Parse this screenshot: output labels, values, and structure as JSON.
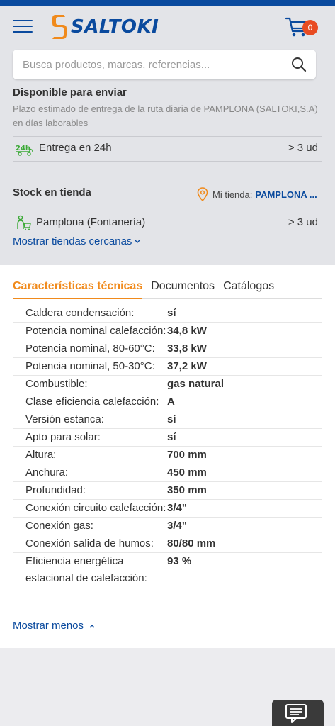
{
  "header": {
    "logo_text": "SALTOKI",
    "cart_count": "0",
    "search_placeholder": "Busca productos, marcas, referencias..."
  },
  "availability": {
    "title": "Disponible para enviar",
    "subtitle": "Plazo estimado de entrega de la ruta diaria de PAMPLONA (SALTOKI,S.A) en días laborables",
    "delivery_label": "Entrega en 24h",
    "delivery_value": "> 3 ud",
    "stock_title": "Stock en tienda",
    "my_store_prefix": "Mi tienda:",
    "my_store_name": "PAMPLONA ...",
    "store_row_label": "Pamplona (Fontanería)",
    "store_row_value": "> 3 ud",
    "show_nearby": "Mostrar tiendas cercanas"
  },
  "tabs": [
    {
      "label": "Características técnicas",
      "active": true
    },
    {
      "label": "Documentos",
      "active": false
    },
    {
      "label": "Catálogos",
      "active": false
    }
  ],
  "specs": [
    {
      "label": "Caldera condensación:",
      "value": "sí"
    },
    {
      "label": "Potencia nominal calefacción:",
      "value": "34,8 kW"
    },
    {
      "label": "Potencia nominal, 80-60°C:",
      "value": "33,8 kW"
    },
    {
      "label": "Potencia nominal, 50-30°C:",
      "value": "37,2 kW"
    },
    {
      "label": "Combustible:",
      "value": "gas natural"
    },
    {
      "label": "Clase eficiencia calefacción:",
      "value": "A"
    },
    {
      "label": "Versión estanca:",
      "value": "sí"
    },
    {
      "label": "Apto para solar:",
      "value": "sí"
    },
    {
      "label": "Altura:",
      "value": "700 mm"
    },
    {
      "label": "Anchura:",
      "value": "450 mm"
    },
    {
      "label": "Profundidad:",
      "value": "350 mm"
    },
    {
      "label": "Conexión circuito calefacción:",
      "value": "3/4\""
    },
    {
      "label": "Conexión gas:",
      "value": "3/4\""
    },
    {
      "label": "Conexión salida de humos:",
      "value": "80/80 mm"
    },
    {
      "label": "Eficiencia energética estacional de calefacción:",
      "value": "93 %"
    }
  ],
  "show_less": "Mostrar menos",
  "colors": {
    "brand_blue": "#0a4a9e",
    "accent_orange": "#f08a1c",
    "badge_red": "#e84b22",
    "icon_green": "#3aa935"
  }
}
